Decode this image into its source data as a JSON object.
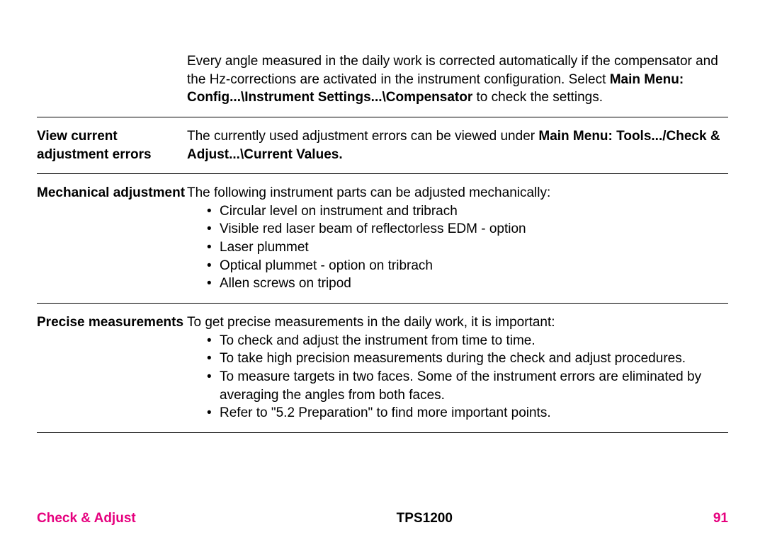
{
  "intro": {
    "part1": "Every angle measured in the daily work is corrected automatically if the compensator and the Hz-corrections are activated in the instrument configuration. Select ",
    "bold1": "Main Menu: Config...\\Instrument Settings...\\Compensator",
    "part2": " to check the settings."
  },
  "sections": {
    "view": {
      "label": "View current adjustment errors",
      "text1": "The currently used adjustment errors can be viewed under ",
      "bold1": "Main Menu: Tools.../Check & Adjust...\\Current Values."
    },
    "mech": {
      "label": "Mechanical adjustment",
      "intro": "The following instrument parts can be adjusted mechanically:",
      "items": [
        "Circular level on instrument and tribrach",
        "Visible red laser beam of reflectorless EDM - option",
        "Laser plummet",
        "Optical plummet - option on tribrach",
        "Allen screws on tripod"
      ]
    },
    "precise": {
      "label": "Precise measurements",
      "intro": "To get precise measurements in the daily work, it is important:",
      "items": [
        "To check and adjust the instrument from time to time.",
        "To take high precision measurements during the check and adjust procedures.",
        "To measure targets in two faces. Some of the instrument errors are eliminated by averaging the angles from both faces.",
        "Refer to \"5.2 Preparation\" to find more important points."
      ]
    }
  },
  "footer": {
    "left": "Check & Adjust",
    "center": "TPS1200",
    "right": "91"
  }
}
